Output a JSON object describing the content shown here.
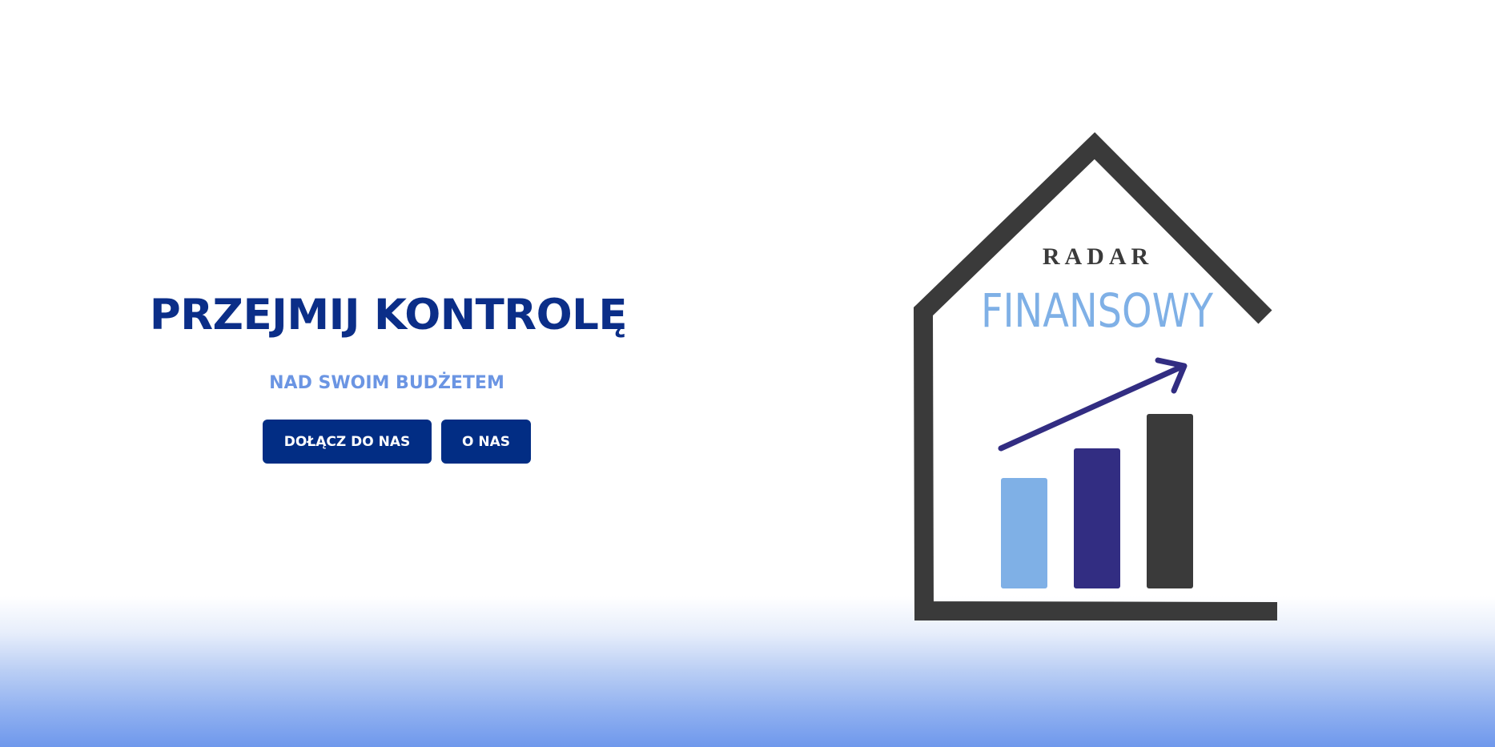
{
  "hero": {
    "headline": "PRZEJMIJ KONTROLĘ",
    "subheadline": "NAD SWOIM BUDŻETEM",
    "buttons": {
      "join_label": "DOŁĄCZ DO NAS",
      "about_label": "O NAS"
    }
  },
  "logo": {
    "line1": "RADAR",
    "line2": "FINANSOWY",
    "growth_bars": [
      0.38,
      0.48,
      0.59
    ],
    "colors": {
      "house": "#3a3a3a",
      "bar1": "#7fb0e6",
      "bar2": "#322d82",
      "bar3": "#3a3a3a",
      "arrow": "#322d82",
      "finansowy": "#7fb0e6"
    }
  },
  "colors": {
    "primary": "#022d84",
    "accent": "#6b95e3",
    "gradient_bottom": "#6f98ec"
  }
}
